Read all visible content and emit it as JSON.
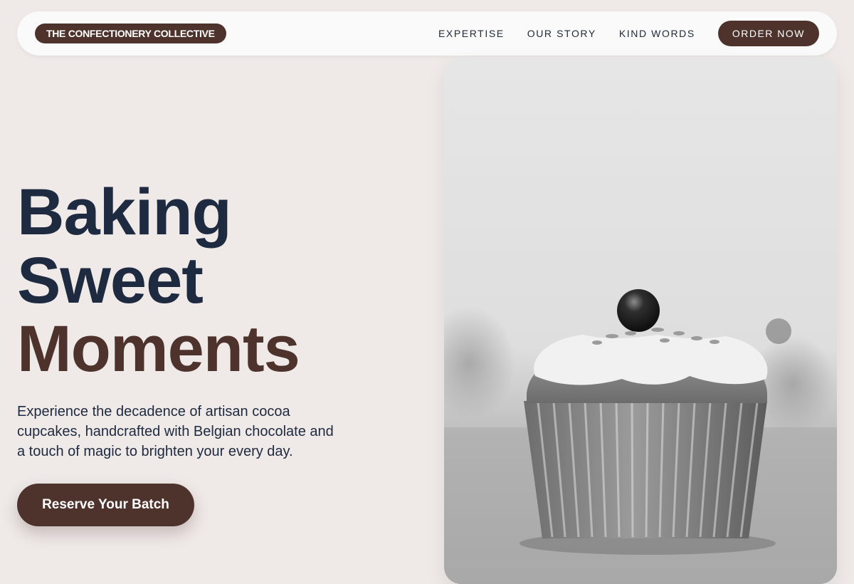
{
  "brand": "THE CONFECTIONERY COLLECTIVE",
  "nav": {
    "links": [
      "EXPERTISE",
      "OUR STORY",
      "KIND WORDS"
    ],
    "cta": "ORDER NOW"
  },
  "hero": {
    "title_lines": [
      "Baking",
      "Sweet",
      "Moments"
    ],
    "description": "Experience the decadence of artisan cocoa cupcakes, handcrafted with Belgian chocolate and a touch of magic to brighten your every day.",
    "cta": "Reserve Your Batch"
  },
  "colors": {
    "accent": "#4e332d",
    "heading": "#1e2a3f",
    "background": "#efe9e8"
  }
}
